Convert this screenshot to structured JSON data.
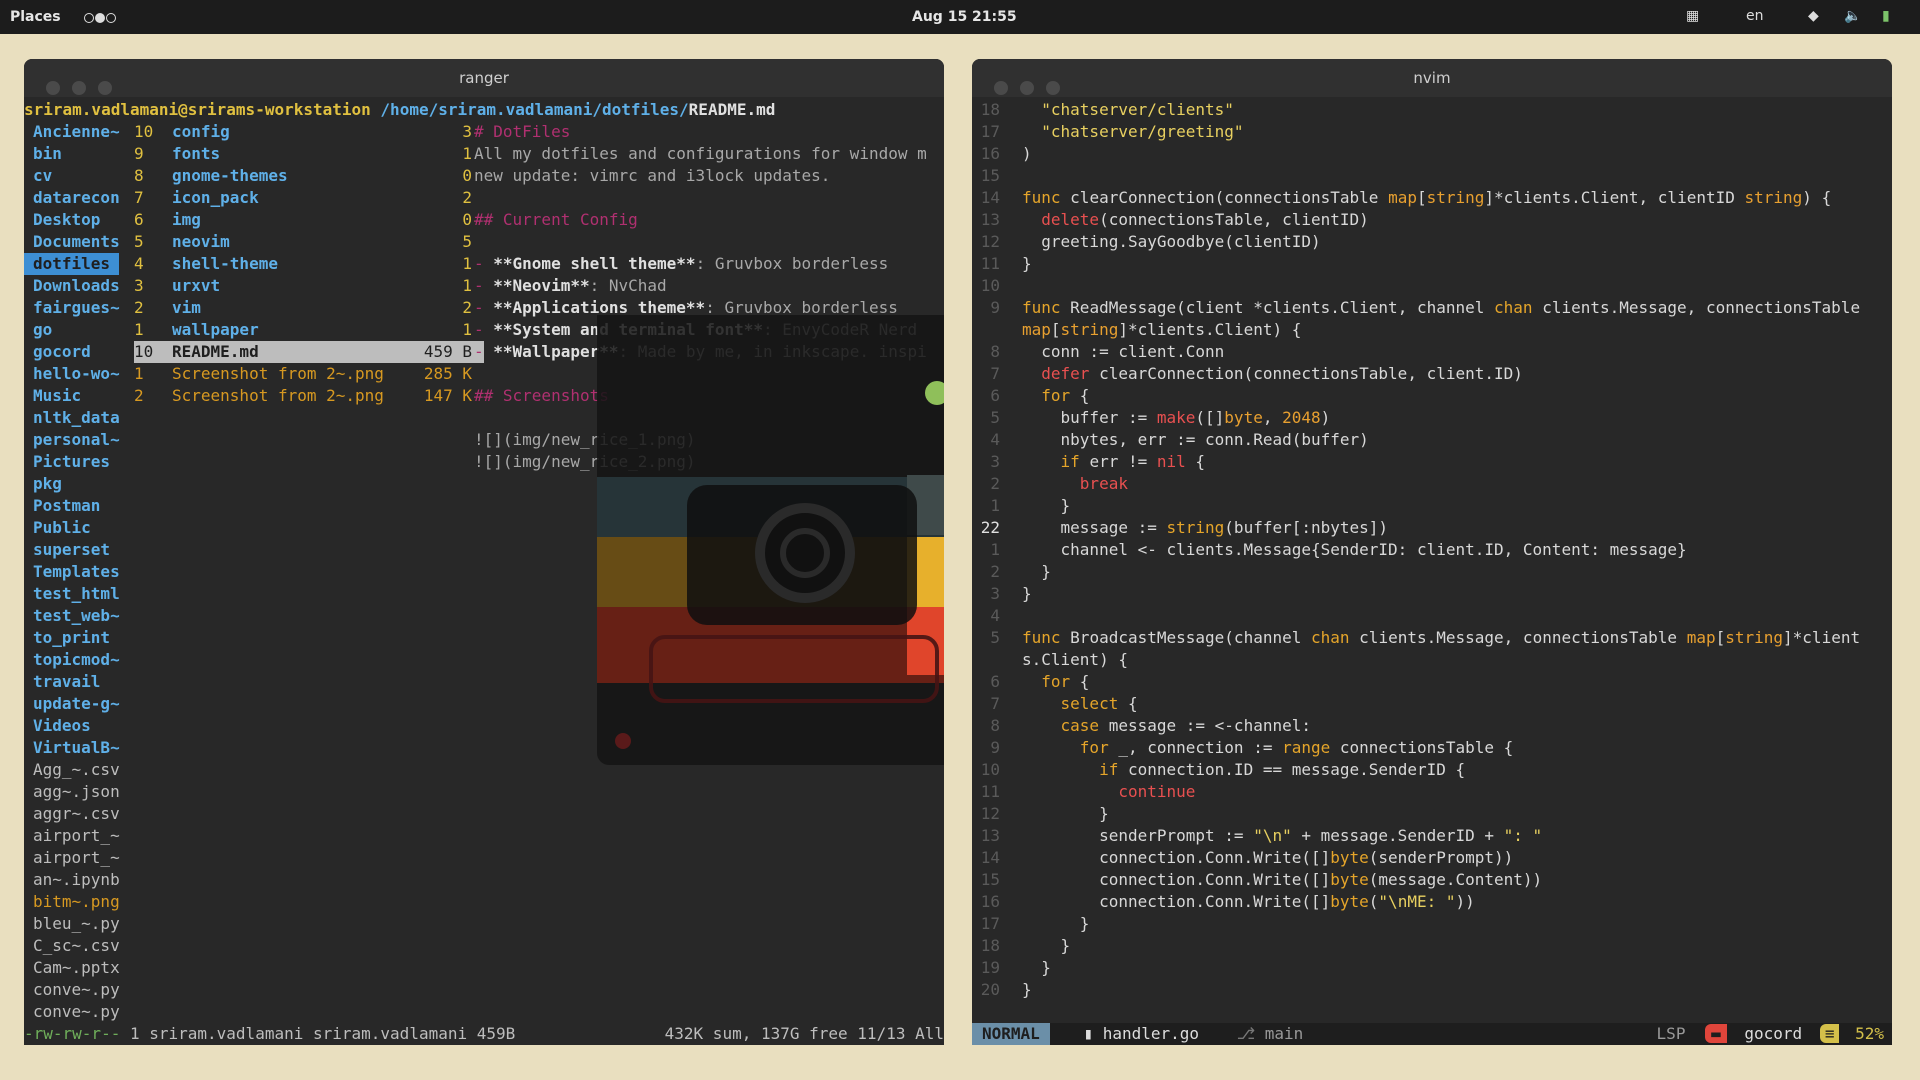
{
  "topbar": {
    "places": "Places",
    "clock": "Aug 15 21:55",
    "lang": "en"
  },
  "ranger": {
    "title": "ranger",
    "path_user": "sriram.vadlamani@srirams-workstation",
    "path_dir": "/home/sriram.vadlamani/dotfiles/",
    "path_file": "README.md",
    "left_col": [
      {
        "t": "Ancienne~",
        "k": "dir"
      },
      {
        "t": "bin",
        "k": "dir"
      },
      {
        "t": "cv",
        "k": "dir"
      },
      {
        "t": "datarecon",
        "k": "dir"
      },
      {
        "t": "Desktop",
        "k": "dir"
      },
      {
        "t": "Documents",
        "k": "dir"
      },
      {
        "t": "dotfiles",
        "k": "sel"
      },
      {
        "t": "Downloads",
        "k": "dir"
      },
      {
        "t": "fairgues~",
        "k": "dir"
      },
      {
        "t": "go",
        "k": "dir"
      },
      {
        "t": "gocord",
        "k": "dir"
      },
      {
        "t": "hello-wo~",
        "k": "dir"
      },
      {
        "t": "Music",
        "k": "dir"
      },
      {
        "t": "nltk_data",
        "k": "dir"
      },
      {
        "t": "personal~",
        "k": "dir"
      },
      {
        "t": "Pictures",
        "k": "dir"
      },
      {
        "t": "pkg",
        "k": "dir"
      },
      {
        "t": "Postman",
        "k": "dir"
      },
      {
        "t": "Public",
        "k": "dir"
      },
      {
        "t": "superset",
        "k": "dir"
      },
      {
        "t": "Templates",
        "k": "dir"
      },
      {
        "t": "test_html",
        "k": "dir"
      },
      {
        "t": "test_web~",
        "k": "dir"
      },
      {
        "t": "to_print",
        "k": "dir"
      },
      {
        "t": "topicmod~",
        "k": "dir"
      },
      {
        "t": "travail",
        "k": "dir"
      },
      {
        "t": "update-g~",
        "k": "dir"
      },
      {
        "t": "Videos",
        "k": "dir"
      },
      {
        "t": "VirtualB~",
        "k": "dir"
      },
      {
        "t": "Agg_~.csv",
        "k": "file"
      },
      {
        "t": "agg~.json",
        "k": "file"
      },
      {
        "t": "aggr~.csv",
        "k": "file"
      },
      {
        "t": "airport_~",
        "k": "file"
      },
      {
        "t": "airport_~",
        "k": "file"
      },
      {
        "t": "an~.ipynb",
        "k": "file"
      },
      {
        "t": "bitm~.png",
        "k": "img"
      },
      {
        "t": "bleu_~.py",
        "k": "file"
      },
      {
        "t": "C_sc~.csv",
        "k": "file"
      },
      {
        "t": "Cam~.pptx",
        "k": "file"
      },
      {
        "t": "conve~.py",
        "k": "file"
      },
      {
        "t": "conve~.py",
        "k": "file"
      }
    ],
    "mid_col": [
      {
        "n": "10",
        "t": "config",
        "c": "3",
        "k": "dir"
      },
      {
        "n": "9",
        "t": "fonts",
        "c": "1",
        "k": "dir"
      },
      {
        "n": "8",
        "t": "gnome-themes",
        "c": "0",
        "k": "dir"
      },
      {
        "n": "7",
        "t": "icon_pack",
        "c": "2",
        "k": "dir"
      },
      {
        "n": "6",
        "t": "img",
        "c": "0",
        "k": "dir"
      },
      {
        "n": "5",
        "t": "neovim",
        "c": "5",
        "k": "dir"
      },
      {
        "n": "4",
        "t": "shell-theme",
        "c": "1",
        "k": "dir"
      },
      {
        "n": "3",
        "t": "urxvt",
        "c": "1",
        "k": "dir"
      },
      {
        "n": "2",
        "t": "vim",
        "c": "2",
        "k": "dir"
      },
      {
        "n": "1",
        "t": "wallpaper",
        "c": "1",
        "k": "dir"
      },
      {
        "n": "10",
        "t": "README.md",
        "c": "459 B",
        "k": "sel"
      },
      {
        "n": "1",
        "t": "Screenshot from 2~.png",
        "c": "285 K",
        "k": "img"
      },
      {
        "n": "2",
        "t": "Screenshot from 2~.png",
        "c": "147 K",
        "k": "img"
      }
    ],
    "preview": [
      {
        "h": "# DotFiles"
      },
      {
        "p": "All my dotfiles and configurations for window m"
      },
      {
        "p": "new update: vimrc and i3lock updates."
      },
      {
        "p": ""
      },
      {
        "h": "## Current Config"
      },
      {
        "p": ""
      },
      {
        "d": "- ",
        "b": "**Gnome shell theme**",
        "r": ": Gruvbox borderless"
      },
      {
        "d": "- ",
        "b": "**Neovim**",
        "r": ": NvChad"
      },
      {
        "d": "- ",
        "b": "**Applications theme**",
        "r": ": Gruvbox borderless"
      },
      {
        "d": "- ",
        "b": "**System and terminal font**",
        "r": ": EnvyCodeR Nerd"
      },
      {
        "d": "- ",
        "b": "**Wallpaper**",
        "r": ": Made by me, in inkscape. inspi"
      },
      {
        "p": ""
      },
      {
        "h": "## Screenshots"
      },
      {
        "p": ""
      },
      {
        "p": "![](img/new_rice_1.png)"
      },
      {
        "p": "![](img/new_rice_2.png)"
      }
    ],
    "status_left": "-rw-rw-r--",
    "status_mid": " 1 sriram.vadlamani sriram.vadlamani 459B",
    "status_right": "432K sum, 137G free  11/13  All"
  },
  "nvim": {
    "title": "nvim",
    "lines": [
      {
        "g": "18",
        "s": [
          [
            "",
            "  "
          ],
          [
            "st",
            "\"chatserver/clients\""
          ]
        ]
      },
      {
        "g": "17",
        "s": [
          [
            "",
            "  "
          ],
          [
            "st",
            "\"chatserver/greeting\""
          ]
        ]
      },
      {
        "g": "16",
        "s": [
          [
            "",
            ")"
          ]
        ]
      },
      {
        "g": "15",
        "s": []
      },
      {
        "g": "14",
        "s": [
          [
            "kw",
            "func "
          ],
          [
            "",
            "clearConnection(connectionsTable "
          ],
          [
            "ty",
            "map"
          ],
          [
            "",
            "["
          ],
          [
            "ty",
            "string"
          ],
          [
            "",
            "]*clients.Client, clientID "
          ],
          [
            "ty",
            "string"
          ],
          [
            "",
            ") {"
          ]
        ]
      },
      {
        "g": "13",
        "s": [
          [
            "",
            "  "
          ],
          [
            "kr",
            "delete"
          ],
          [
            "",
            "(connectionsTable, clientID)"
          ]
        ]
      },
      {
        "g": "12",
        "s": [
          [
            "",
            "  greeting.SayGoodbye(clientID)"
          ]
        ]
      },
      {
        "g": "11",
        "s": [
          [
            "",
            "}"
          ]
        ]
      },
      {
        "g": "10",
        "s": []
      },
      {
        "g": "9",
        "s": [
          [
            "kw",
            "func "
          ],
          [
            "",
            "ReadMessage(client *clients.Client, channel "
          ],
          [
            "kw",
            "chan "
          ],
          [
            "",
            "clients.Message, connectionsTable"
          ]
        ]
      },
      {
        "g": "",
        "s": [
          [
            "",
            ""
          ],
          [
            "ty",
            "map"
          ],
          [
            "",
            "["
          ],
          [
            "ty",
            "string"
          ],
          [
            "",
            "]*clients.Client) {"
          ]
        ]
      },
      {
        "g": "8",
        "s": [
          [
            "",
            "  conn := client.Conn"
          ]
        ]
      },
      {
        "g": "7",
        "s": [
          [
            "",
            "  "
          ],
          [
            "kr",
            "defer "
          ],
          [
            "",
            "clearConnection(connectionsTable, client.ID)"
          ]
        ]
      },
      {
        "g": "6",
        "s": [
          [
            "",
            "  "
          ],
          [
            "kw",
            "for "
          ],
          [
            "",
            "{"
          ]
        ]
      },
      {
        "g": "5",
        "s": [
          [
            "",
            "    buffer := "
          ],
          [
            "kr",
            "make"
          ],
          [
            "",
            "([]"
          ],
          [
            "ty",
            "byte"
          ],
          [
            "",
            ", "
          ],
          [
            "ty",
            "2048"
          ],
          [
            "",
            ")"
          ]
        ]
      },
      {
        "g": "4",
        "s": [
          [
            "",
            "    nbytes, err := conn.Read(buffer)"
          ]
        ]
      },
      {
        "g": "3",
        "s": [
          [
            "",
            "    "
          ],
          [
            "kw",
            "if "
          ],
          [
            "",
            "err != "
          ],
          [
            "kr",
            "nil "
          ],
          [
            "",
            "{"
          ]
        ]
      },
      {
        "g": "2",
        "s": [
          [
            "",
            "      "
          ],
          [
            "kr",
            "break"
          ]
        ]
      },
      {
        "g": "1",
        "s": [
          [
            "",
            "    }"
          ]
        ]
      },
      {
        "g": "22",
        "s": [
          [
            "",
            "    message := "
          ],
          [
            "kw",
            "string"
          ],
          [
            "",
            "(buffer[:nbytes])"
          ]
        ]
      },
      {
        "g": "1",
        "s": [
          [
            "",
            "    channel <- clients.Message{SenderID: client.ID, Content: message}"
          ]
        ]
      },
      {
        "g": "2",
        "s": [
          [
            "",
            "  }"
          ]
        ]
      },
      {
        "g": "3",
        "s": [
          [
            "",
            "}"
          ]
        ]
      },
      {
        "g": "4",
        "s": []
      },
      {
        "g": "5",
        "s": [
          [
            "kw",
            "func "
          ],
          [
            "",
            "BroadcastMessage(channel "
          ],
          [
            "kw",
            "chan "
          ],
          [
            "",
            "clients.Message, connectionsTable "
          ],
          [
            "ty",
            "map"
          ],
          [
            "",
            "["
          ],
          [
            "ty",
            "string"
          ],
          [
            "",
            "]*client"
          ]
        ]
      },
      {
        "g": "",
        "s": [
          [
            "",
            "s.Client) {"
          ]
        ]
      },
      {
        "g": "6",
        "s": [
          [
            "",
            "  "
          ],
          [
            "kw",
            "for "
          ],
          [
            "",
            "{"
          ]
        ]
      },
      {
        "g": "7",
        "s": [
          [
            "",
            "    "
          ],
          [
            "kw",
            "select "
          ],
          [
            "",
            "{"
          ]
        ]
      },
      {
        "g": "8",
        "s": [
          [
            "",
            "    "
          ],
          [
            "kw",
            "case "
          ],
          [
            "",
            "message := <-channel:"
          ]
        ]
      },
      {
        "g": "9",
        "s": [
          [
            "",
            "      "
          ],
          [
            "kw",
            "for "
          ],
          [
            "",
            "_, connection := "
          ],
          [
            "kw",
            "range "
          ],
          [
            "",
            "connectionsTable {"
          ]
        ]
      },
      {
        "g": "10",
        "s": [
          [
            "",
            "        "
          ],
          [
            "kw",
            "if "
          ],
          [
            "",
            "connection.ID == message.SenderID {"
          ]
        ]
      },
      {
        "g": "11",
        "s": [
          [
            "",
            "          "
          ],
          [
            "kr",
            "continue"
          ]
        ]
      },
      {
        "g": "12",
        "s": [
          [
            "",
            "        }"
          ]
        ]
      },
      {
        "g": "13",
        "s": [
          [
            "",
            "        senderPrompt := "
          ],
          [
            "st",
            "\"\\n\""
          ],
          [
            "",
            " + message.SenderID + "
          ],
          [
            "st",
            "\": \""
          ]
        ]
      },
      {
        "g": "14",
        "s": [
          [
            "",
            "        connection.Conn.Write([]"
          ],
          [
            "kw",
            "byte"
          ],
          [
            "",
            "(senderPrompt))"
          ]
        ]
      },
      {
        "g": "15",
        "s": [
          [
            "",
            "        connection.Conn.Write([]"
          ],
          [
            "kw",
            "byte"
          ],
          [
            "",
            "(message.Content))"
          ]
        ]
      },
      {
        "g": "16",
        "s": [
          [
            "",
            "        connection.Conn.Write([]"
          ],
          [
            "kw",
            "byte"
          ],
          [
            "",
            "("
          ],
          [
            "st",
            "\"\\nME: \""
          ],
          [
            "",
            "))"
          ]
        ]
      },
      {
        "g": "17",
        "s": [
          [
            "",
            "      }"
          ]
        ]
      },
      {
        "g": "18",
        "s": [
          [
            "",
            "    }"
          ]
        ]
      },
      {
        "g": "19",
        "s": [
          [
            "",
            "  }"
          ]
        ]
      },
      {
        "g": "20",
        "s": [
          [
            "",
            "}"
          ]
        ]
      }
    ],
    "mode": "NORMAL",
    "file": "handler.go",
    "branch": "main",
    "lsp": "LSP",
    "project": "gocord",
    "percent": "52%"
  }
}
